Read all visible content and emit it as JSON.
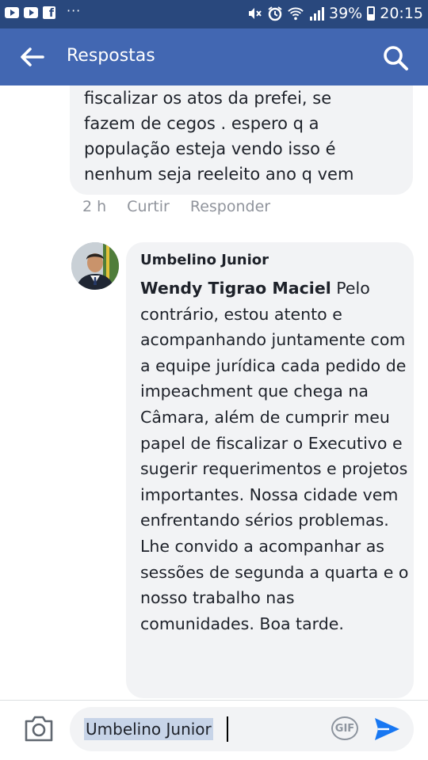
{
  "status_bar": {
    "overflow_indicator": "···",
    "battery_percent": "39%",
    "time": "20:15"
  },
  "app_bar": {
    "title": "Respostas",
    "back_icon": "arrow-left-icon",
    "search_icon": "search-icon"
  },
  "previous_comment": {
    "lines": [
      "fiscalizar os atos da prefei, se",
      "fazem de cegos . espero q a",
      "população esteja vendo isso é",
      "nenhum seja reeleito ano q vem"
    ],
    "time": "2 h",
    "like_label": "Curtir",
    "reply_label": "Responder"
  },
  "reply": {
    "author": "Umbelino Junior",
    "mention": "Wendy Tigrao Maciel",
    "text": " Pelo contrário, estou atento e acompanhando juntamente com a equipe jurídica cada pedido de impeachment que chega na Câmara, além de cumprir meu papel de fiscalizar o Executivo e sugerir requerimentos e projetos importantes. Nossa cidade vem enfrentando sérios problemas. Lhe convido a acompanhar as sessões de segunda a quarta e o nosso trabalho nas comunidades. Boa tarde."
  },
  "composer": {
    "value": "Umbelino Junior",
    "gif_label": "GIF",
    "camera_icon": "camera-icon",
    "send_icon": "send-icon"
  },
  "colors": {
    "app_bar": "#4267b2",
    "status_bar": "#29487d",
    "bubble": "#f2f3f5",
    "send": "#1877f2"
  }
}
